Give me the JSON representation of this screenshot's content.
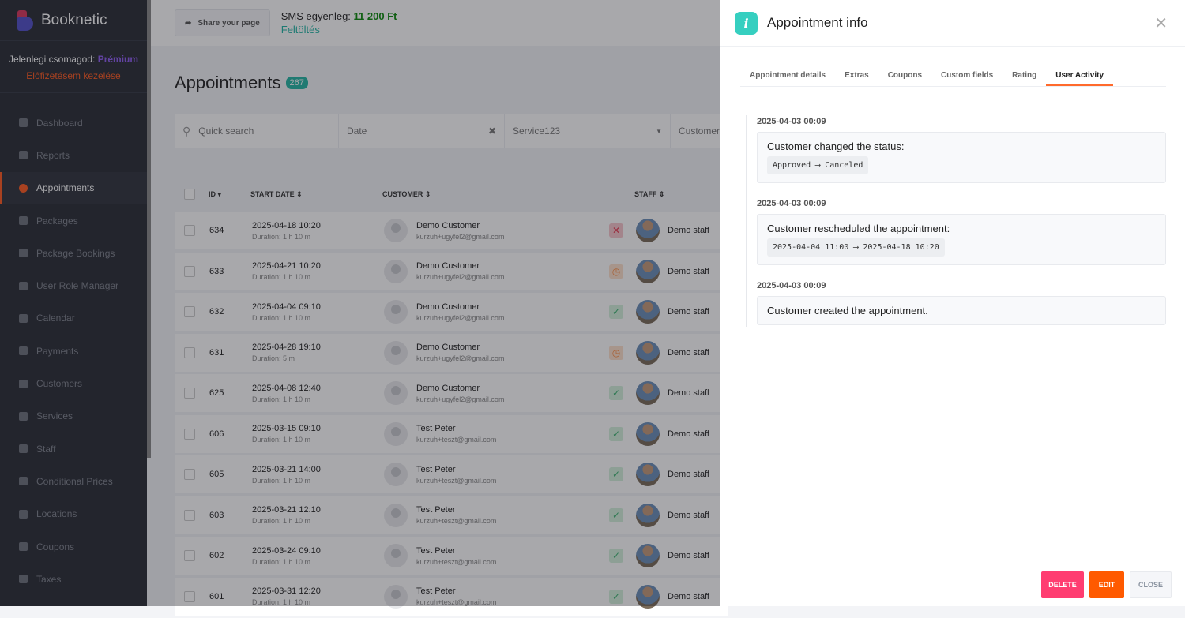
{
  "sidebar": {
    "brand": "Booknetic",
    "plan_label": "Jelenlegi csomagod:",
    "plan_name": "Prémium",
    "manage": "Előfizetésem kezelése",
    "items": [
      {
        "label": "Dashboard"
      },
      {
        "label": "Reports"
      },
      {
        "label": "Appointments",
        "active": true
      },
      {
        "label": "Packages"
      },
      {
        "label": "Package Bookings"
      },
      {
        "label": "User Role Manager"
      },
      {
        "label": "Calendar"
      },
      {
        "label": "Payments"
      },
      {
        "label": "Customers"
      },
      {
        "label": "Services"
      },
      {
        "label": "Staff"
      },
      {
        "label": "Conditional Prices"
      },
      {
        "label": "Locations"
      },
      {
        "label": "Coupons"
      },
      {
        "label": "Taxes"
      }
    ]
  },
  "topbar": {
    "share": "Share your page",
    "sms_label": "SMS egyenleg:",
    "sms_value": "11 200 Ft",
    "topup": "Feltöltés"
  },
  "page": {
    "title": "Appointments",
    "count": "267"
  },
  "filters": {
    "search_placeholder": "Quick search",
    "date": "Date",
    "service": "Service123",
    "customer": "Customer"
  },
  "table": {
    "headers": {
      "id": "ID",
      "start": "START DATE",
      "customer": "CUSTOMER",
      "staff": "STAFF"
    },
    "rows": [
      {
        "id": "634",
        "date": "2025-04-18 10:20",
        "duration": "Duration: 1 h 10 m",
        "name": "Demo Customer",
        "email": "kurzuh+ugyfel2@gmail.com",
        "status": "canceled",
        "staff": "Demo staff"
      },
      {
        "id": "633",
        "date": "2025-04-21 10:20",
        "duration": "Duration: 1 h 10 m",
        "name": "Demo Customer",
        "email": "kurzuh+ugyfel2@gmail.com",
        "status": "pending",
        "staff": "Demo staff"
      },
      {
        "id": "632",
        "date": "2025-04-04 09:10",
        "duration": "Duration: 1 h 10 m",
        "name": "Demo Customer",
        "email": "kurzuh+ugyfel2@gmail.com",
        "status": "approved",
        "staff": "Demo staff"
      },
      {
        "id": "631",
        "date": "2025-04-28 19:10",
        "duration": "Duration: 5 m",
        "name": "Demo Customer",
        "email": "kurzuh+ugyfel2@gmail.com",
        "status": "pending",
        "staff": "Demo staff"
      },
      {
        "id": "625",
        "date": "2025-04-08 12:40",
        "duration": "Duration: 1 h 10 m",
        "name": "Demo Customer",
        "email": "kurzuh+ugyfel2@gmail.com",
        "status": "approved",
        "staff": "Demo staff"
      },
      {
        "id": "606",
        "date": "2025-03-15 09:10",
        "duration": "Duration: 1 h 10 m",
        "name": "Test Peter",
        "email": "kurzuh+teszt@gmail.com",
        "status": "approved",
        "staff": "Demo staff"
      },
      {
        "id": "605",
        "date": "2025-03-21 14:00",
        "duration": "Duration: 1 h 10 m",
        "name": "Test Peter",
        "email": "kurzuh+teszt@gmail.com",
        "status": "approved",
        "staff": "Demo staff"
      },
      {
        "id": "603",
        "date": "2025-03-21 12:10",
        "duration": "Duration: 1 h 10 m",
        "name": "Test Peter",
        "email": "kurzuh+teszt@gmail.com",
        "status": "approved",
        "staff": "Demo staff"
      },
      {
        "id": "602",
        "date": "2025-03-24 09:10",
        "duration": "Duration: 1 h 10 m",
        "name": "Test Peter",
        "email": "kurzuh+teszt@gmail.com",
        "status": "approved",
        "staff": "Demo staff"
      },
      {
        "id": "601",
        "date": "2025-03-31 12:20",
        "duration": "Duration: 1 h 10 m",
        "name": "Test Peter",
        "email": "kurzuh+teszt@gmail.com",
        "status": "approved",
        "staff": "Demo staff"
      }
    ]
  },
  "panel": {
    "title": "Appointment info",
    "tabs": [
      "Appointment details",
      "Extras",
      "Coupons",
      "Custom fields",
      "Rating",
      "User Activity"
    ],
    "active_tab": "User Activity",
    "activity": [
      {
        "time": "2025-04-03 00:09",
        "text": "Customer changed the status:",
        "code": "Approved ⟶ Canceled"
      },
      {
        "time": "2025-04-03 00:09",
        "text": "Customer rescheduled the appointment:",
        "code": "2025-04-04 11:00 ⟶ 2025-04-18 10:20"
      },
      {
        "time": "2025-04-03 00:09",
        "text": "Customer created the appointment."
      }
    ],
    "buttons": {
      "delete": "DELETE",
      "edit": "EDIT",
      "close": "CLOSE"
    }
  },
  "colors": {
    "accent": "#ff5a1f",
    "teal": "#24b5a3",
    "delete": "#ff3d71",
    "canceled": "#e8384f",
    "pending": "#ff8a3d",
    "approved": "#3cb371"
  }
}
